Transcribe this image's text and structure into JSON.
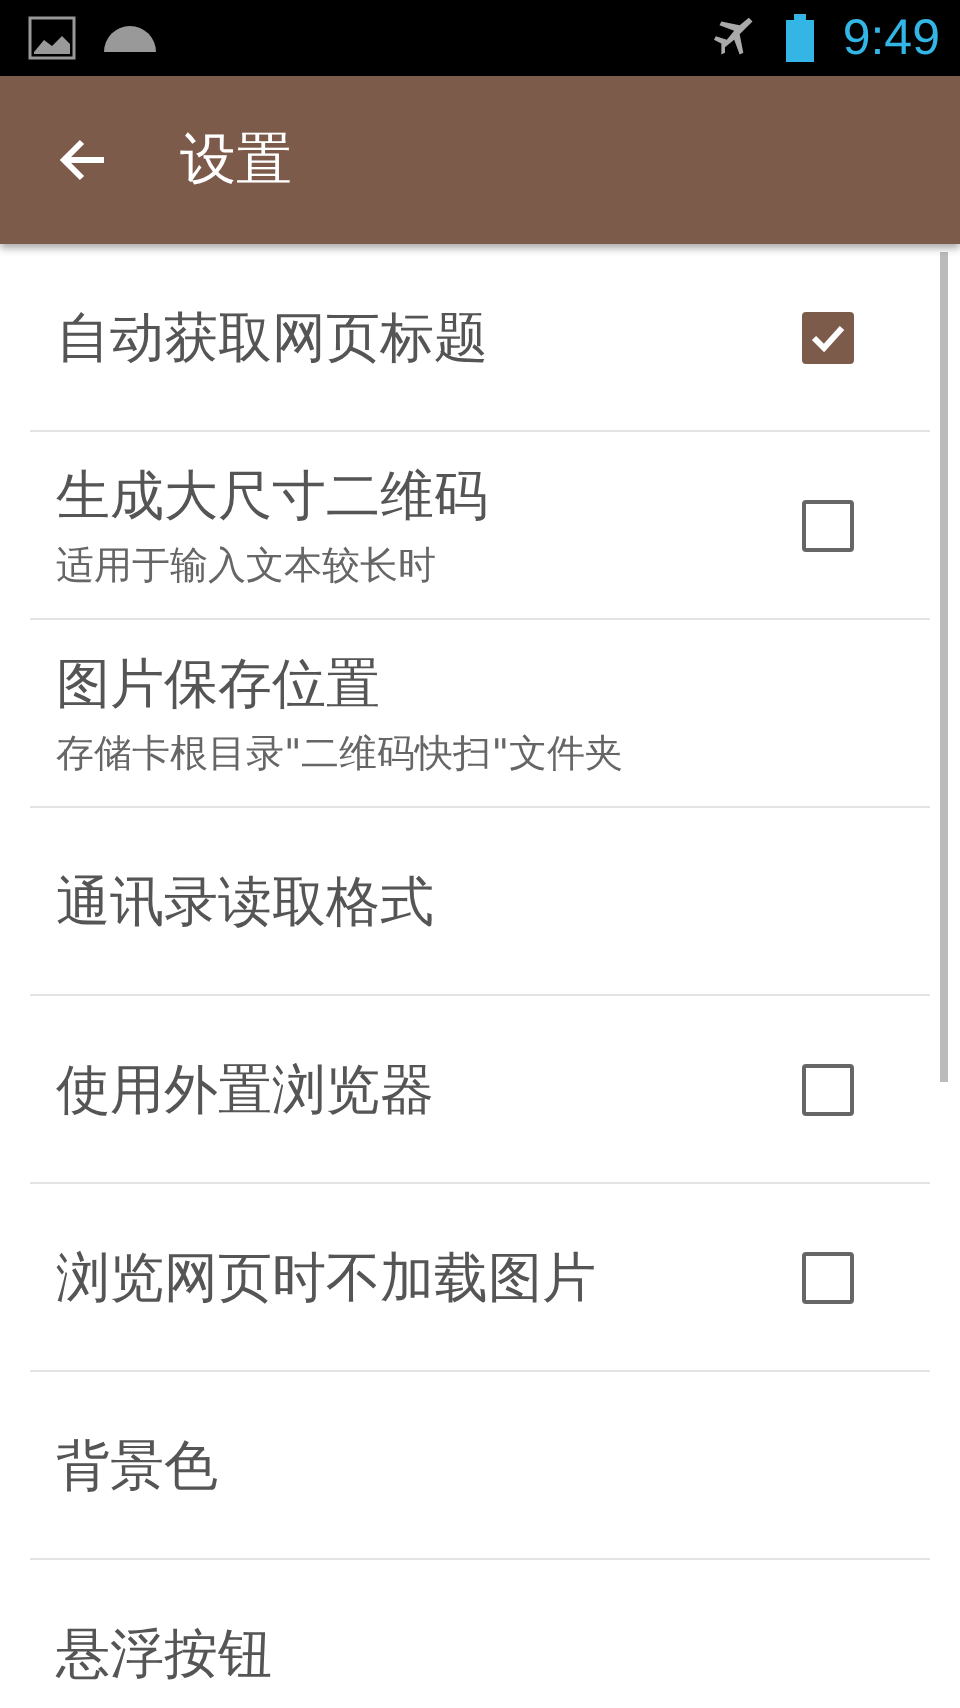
{
  "status_bar": {
    "time": "9:49"
  },
  "app_bar": {
    "title": "设置"
  },
  "settings": [
    {
      "kind": "checkbox",
      "title": "自动获取网页标题",
      "checked": true
    },
    {
      "kind": "checkbox",
      "title": "生成大尺寸二维码",
      "summary": "适用于输入文本较长时",
      "checked": false
    },
    {
      "kind": "plain",
      "title": "图片保存位置",
      "summary": "存储卡根目录\"二维码快扫\"文件夹"
    },
    {
      "kind": "plain",
      "title": "通讯录读取格式"
    },
    {
      "kind": "checkbox",
      "title": "使用外置浏览器",
      "checked": false
    },
    {
      "kind": "checkbox",
      "title": "浏览网页时不加载图片",
      "checked": false
    },
    {
      "kind": "plain",
      "title": "背景色"
    },
    {
      "kind": "plain",
      "title": "悬浮按钮"
    }
  ]
}
